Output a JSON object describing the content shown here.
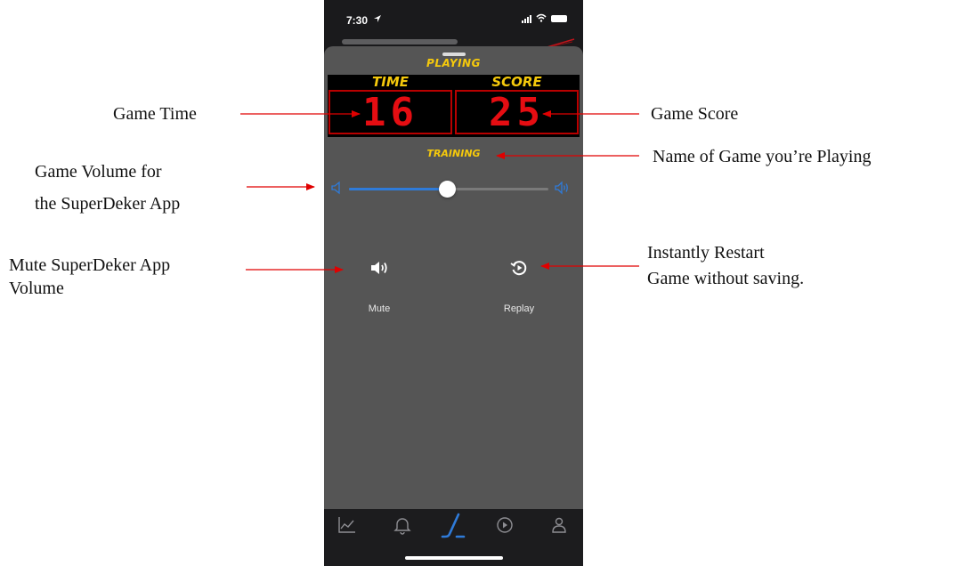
{
  "status_bar": {
    "time": "7:30"
  },
  "game": {
    "status": "PLAYING",
    "time_header": "TIME",
    "score_header": "SCORE",
    "time_value": "16",
    "score_value": "25",
    "name": "TRAINING"
  },
  "volume": {
    "level_fraction": 0.49
  },
  "controls": {
    "mute_label": "Mute",
    "replay_label": "Replay"
  },
  "tab_bar": {
    "tabs": [
      {
        "icon": "chart-icon",
        "active": false
      },
      {
        "icon": "bell-icon",
        "active": false
      },
      {
        "icon": "hockey-stick-icon",
        "active": true
      },
      {
        "icon": "play-circle-icon",
        "active": false
      },
      {
        "icon": "person-icon",
        "active": false
      }
    ]
  },
  "annotations": {
    "game_time": "Game Time",
    "game_volume_line1": "Game Volume for",
    "game_volume_line2": "the SuperDeker App",
    "mute_line1": "Mute SuperDeker App",
    "mute_line2": "Volume",
    "game_score": "Game Score",
    "game_name": "Name of Game you’re Playing",
    "restart_line1": "Instantly Restart",
    "restart_line2": "Game without saving."
  },
  "colors": {
    "accent_yellow": "#f5c90c",
    "scoreboard_red": "#e50d12",
    "slider_blue": "#2f7bd9",
    "arrow_red": "#e00000",
    "sheet_gray": "#555555"
  }
}
